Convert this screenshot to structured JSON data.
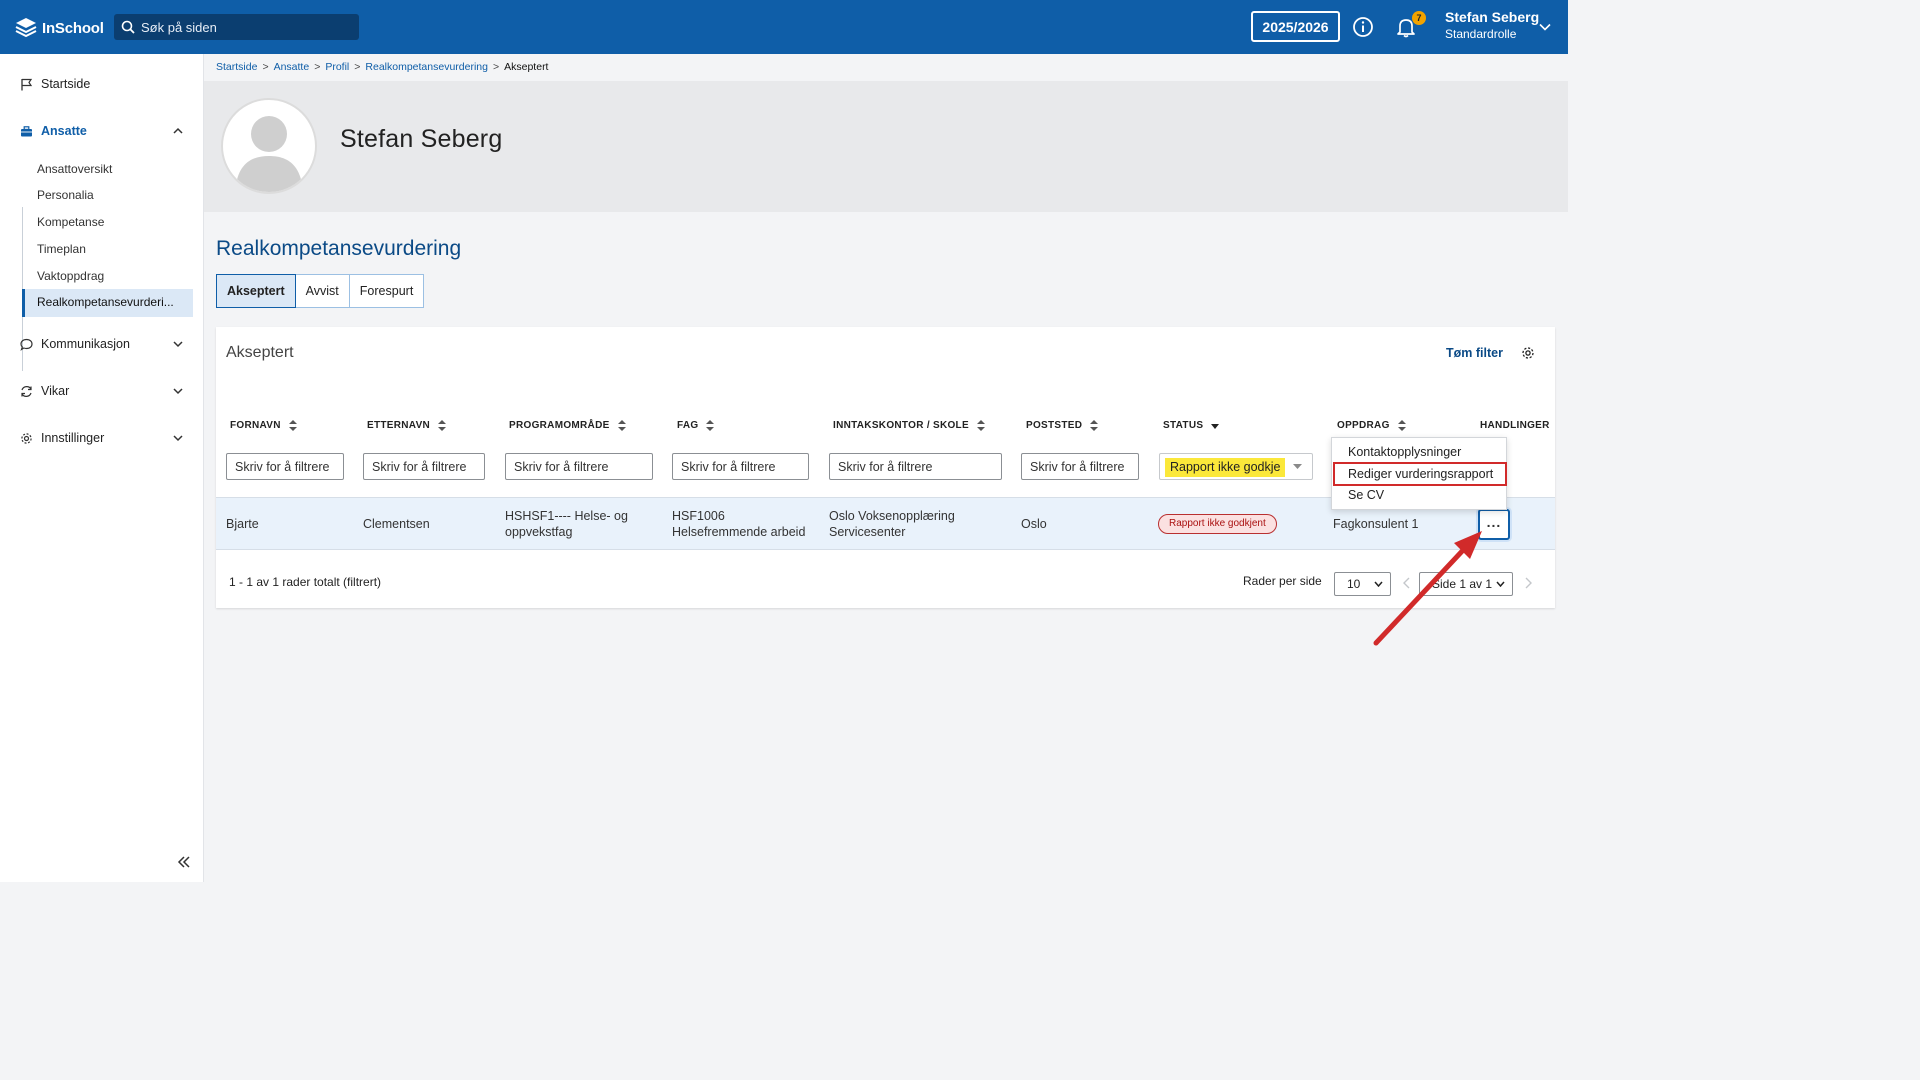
{
  "app": {
    "logo_text": "InSchool",
    "search_placeholder": "Søk på siden",
    "school_year": "2025/2026",
    "notification_count": "7",
    "user_name": "Stefan Seberg",
    "user_role": "Standardrolle"
  },
  "sidebar": {
    "items": [
      {
        "label": "Startside"
      },
      {
        "label": "Ansatte"
      },
      {
        "label": "Kommunikasjon"
      },
      {
        "label": "Vikar"
      },
      {
        "label": "Innstillinger"
      }
    ],
    "subitems": [
      {
        "label": "Ansattoversikt"
      },
      {
        "label": "Personalia"
      },
      {
        "label": "Kompetanse"
      },
      {
        "label": "Timeplan"
      },
      {
        "label": "Vaktoppdrag"
      },
      {
        "label": "Realkompetansevurderi..."
      }
    ]
  },
  "breadcrumb": [
    "Startside",
    "Ansatte",
    "Profil",
    "Realkompetansevurdering",
    "Akseptert"
  ],
  "profile": {
    "name": "Stefan Seberg"
  },
  "page": {
    "title": "Realkompetansevurdering"
  },
  "tabs": [
    {
      "label": "Akseptert"
    },
    {
      "label": "Avvist"
    },
    {
      "label": "Forespurt"
    }
  ],
  "table": {
    "title": "Akseptert",
    "clear_filter": "Tøm filter",
    "columns": [
      "FORNAVN",
      "ETTERNAVN",
      "PROGRAMOMRÅDE",
      "FAG",
      "INNTAKSKONTOR / SKOLE",
      "POSTSTED",
      "STATUS",
      "OPPDRAG",
      "HANDLINGER"
    ],
    "filter_placeholder": "Skriv for å filtrere",
    "status_filter_value": "Rapport ikke godkje",
    "rows": [
      {
        "fornavn": "Bjarte",
        "etternavn": "Clementsen",
        "programomrade_1": "HSHSF1---- Helse- og",
        "programomrade_2": "oppvekstfag",
        "fag_1": "HSF1006",
        "fag_2": "Helsefremmende arbeid",
        "skole_1": "Oslo Voksenopplæring",
        "skole_2": "Servicesenter",
        "poststed": "Oslo",
        "status": "Rapport ikke godkjent",
        "oppdrag": "Fagkonsulent 1",
        "actions_label": "..."
      }
    ],
    "footer_count": "1 - 1 av 1 rader totalt (filtrert)",
    "rows_per_page_label": "Rader per side",
    "rows_per_page_value": "10",
    "page_value": "Side 1 av 1"
  },
  "actions_menu": {
    "items": [
      "Kontaktopplysninger",
      "Rediger vurderingsrapport",
      "Se CV"
    ]
  },
  "colors": {
    "brand": "#0f5ea8",
    "highlight_yellow": "#fbe83a",
    "annotation_red": "#d12a2a"
  }
}
